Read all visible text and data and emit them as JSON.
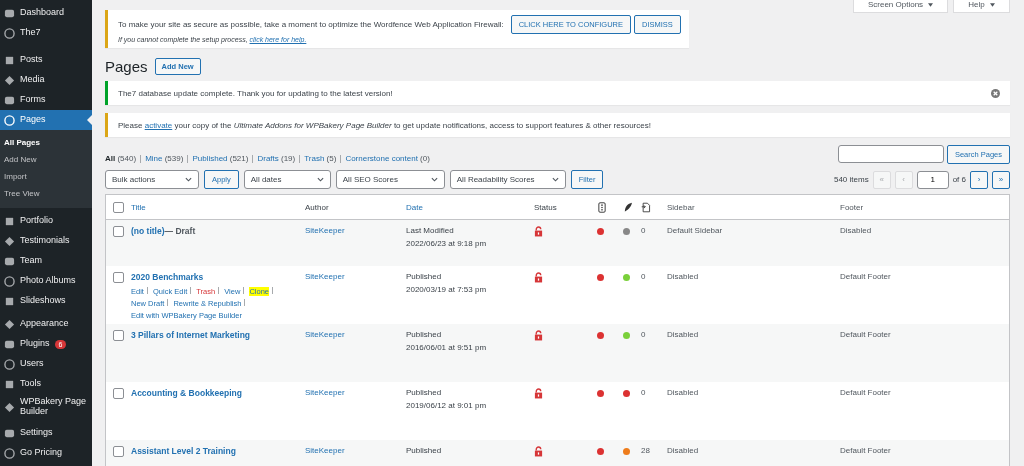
{
  "sidebar": {
    "items": [
      {
        "label": "Dashboard",
        "kind": "item",
        "selected": false
      },
      {
        "label": "The7",
        "kind": "item",
        "selected": false
      },
      {
        "label": "Posts",
        "kind": "item",
        "selected": false
      },
      {
        "label": "Media",
        "kind": "item",
        "selected": false
      },
      {
        "label": "Forms",
        "kind": "item",
        "selected": false
      },
      {
        "label": "Pages",
        "kind": "item",
        "selected": true
      },
      {
        "label": "All Pages",
        "kind": "sub",
        "selected": true
      },
      {
        "label": "Add New",
        "kind": "sub",
        "selected": false
      },
      {
        "label": "Import",
        "kind": "sub",
        "selected": false
      },
      {
        "label": "Tree View",
        "kind": "sub",
        "selected": false
      },
      {
        "label": "Portfolio",
        "kind": "item",
        "selected": false
      },
      {
        "label": "Testimonials",
        "kind": "item",
        "selected": false
      },
      {
        "label": "Team",
        "kind": "item",
        "selected": false
      },
      {
        "label": "Photo Albums",
        "kind": "item",
        "selected": false
      },
      {
        "label": "Slideshows",
        "kind": "item",
        "selected": false
      },
      {
        "label": "Appearance",
        "kind": "item",
        "selected": false
      },
      {
        "label": "Plugins",
        "kind": "item",
        "selected": false,
        "badge": "6"
      },
      {
        "label": "Users",
        "kind": "item",
        "selected": false
      },
      {
        "label": "Tools",
        "kind": "item",
        "selected": false
      },
      {
        "label": "WPBakery Page Builder",
        "kind": "item",
        "selected": false
      },
      {
        "label": "Settings",
        "kind": "item",
        "selected": false
      },
      {
        "label": "Go Pricing",
        "kind": "item",
        "selected": false
      }
    ]
  },
  "top_buttons": [
    "Screen Options",
    "Help"
  ],
  "firewall_notice": {
    "text": "To make your site as secure as possible, take a moment to optimize the Wordfence Web Application Firewall:",
    "buttons": [
      "CLICK HERE TO CONFIGURE",
      "DISMISS"
    ],
    "help_text": "If you cannot complete the setup process,",
    "help_link": "click here for help."
  },
  "heading": {
    "title": "Pages",
    "button": "Add New"
  },
  "update_notice": {
    "text": "The7 database update complete. Thank you for updating to the latest version!"
  },
  "activate_notice": {
    "before": "Please",
    "link": "activate",
    "after": "your copy of the *Ultimate Addons for WPBakery Page Builder* to get update notifications, access to support features & other resources!"
  },
  "filters": [
    {
      "label": "All",
      "count": "(540)",
      "selected": true
    },
    {
      "label": "Mine",
      "count": "(539)",
      "selected": false
    },
    {
      "label": "Published",
      "count": "(521)",
      "selected": false
    },
    {
      "label": "Drafts",
      "count": "(19)",
      "selected": false
    },
    {
      "label": "Trash",
      "count": "(5)",
      "selected": false
    },
    {
      "label": "Cornerstone content",
      "count": "(0)",
      "selected": false
    }
  ],
  "search": {
    "button": "Search Pages"
  },
  "bulk_actions": {
    "value": "Bulk actions",
    "button": "Apply"
  },
  "dropdowns": [
    "All dates",
    "All SEO Scores",
    "All Readability Scores"
  ],
  "filter_button": "Filter",
  "pagination": {
    "items": "540 items",
    "first": "«",
    "prev": "‹",
    "page": "1",
    "of": "of 6",
    "next": "›",
    "last": "»"
  },
  "table": {
    "select_all": {
      "checked": false
    },
    "columns": [
      {
        "label": "Title",
        "kind": "sortable"
      },
      {
        "label": "Author",
        "kind": "plain"
      },
      {
        "label": "Date",
        "kind": "sortable"
      },
      {
        "label": "Status",
        "kind": "plain"
      },
      {
        "kind": "seo"
      },
      {
        "kind": "readability"
      },
      {
        "kind": "links"
      },
      {
        "label": "Sidebar",
        "kind": "plain"
      },
      {
        "label": "Footer",
        "kind": "plain"
      }
    ],
    "rows": [
      {
        "title": "(no title)",
        "state": "— Draft",
        "author": "SiteKeeper",
        "date_status": "Last Modified",
        "date": "2022/06/23 at 9:18 pm",
        "seo": {
          "color": "#dc3232"
        },
        "readability": {
          "color": "#888888"
        },
        "links": "0",
        "sidebar": "Default Sidebar",
        "footer": "Disabled",
        "checked": false
      },
      {
        "title": "2020 Benchmarks",
        "author": "SiteKeeper",
        "date_status": "Published",
        "date": "2020/03/19 at 7:53 pm",
        "seo": {
          "color": "#dc3232"
        },
        "readability": {
          "color": "#7ad03a"
        },
        "links": "0",
        "sidebar": "Disabled",
        "footer": "Default Footer",
        "checked": false,
        "actions": [
          {
            "label": "Edit",
            "kind": "link"
          },
          {
            "label": "Quick Edit",
            "kind": "link"
          },
          {
            "label": "Trash",
            "kind": "delete"
          },
          {
            "label": "View",
            "kind": "link"
          },
          {
            "label": "Clone",
            "kind": "highlight"
          },
          {
            "label": "New Draft",
            "kind": "link"
          },
          {
            "label": "Rewrite & Republish",
            "kind": "link"
          },
          {
            "label": "Edit with WPBakery Page Builder",
            "kind": "link"
          }
        ]
      },
      {
        "title": "3 Pillars of Internet Marketing",
        "author": "SiteKeeper",
        "date_status": "Published",
        "date": "2016/06/01 at 9:51 pm",
        "seo": {
          "color": "#dc3232"
        },
        "readability": {
          "color": "#7ad03a"
        },
        "links": "0",
        "sidebar": "Disabled",
        "footer": "Default Footer",
        "checked": false
      },
      {
        "title": "Accounting & Bookkeeping",
        "author": "SiteKeeper",
        "date_status": "Published",
        "date": "2019/06/12 at 9:01 pm",
        "seo": {
          "color": "#dc3232"
        },
        "readability": {
          "color": "#dc3232"
        },
        "links": "0",
        "sidebar": "Disabled",
        "footer": "Default Footer",
        "checked": false
      },
      {
        "title": "Assistant Level 2 Training",
        "author": "SiteKeeper",
        "date_status": "Published",
        "seo": {
          "color": "#dc3232"
        },
        "readability": {
          "color": "#ee7c1b"
        },
        "links": "28",
        "sidebar": "Disabled",
        "footer": "Default Footer",
        "checked": false
      }
    ]
  }
}
